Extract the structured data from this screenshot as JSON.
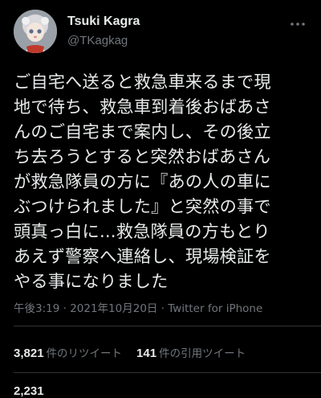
{
  "author": {
    "display_name": "Tsuki Kagra",
    "handle": "@TKagkag",
    "avatar_icon": "doll-avatar"
  },
  "more_icon": "more-dots-icon",
  "tweet": {
    "lines": [
      "ご自宅へ送ると救急車来るまで現",
      "地で待ち、救急車到着後おばあさ",
      "んのご自宅まで案内し、その後立",
      "ち去ろうとすると突然おばあさん",
      "が救急隊員の方に『あの人の車に",
      "ぶつけられました』と突然の事で",
      "頭真っ白に...救急隊員の方もとり",
      "あえず警察へ連絡し、現場検証を",
      "やる事になりました"
    ]
  },
  "meta": {
    "time": "午後3:19",
    "separator": " · ",
    "date": "2021年10月20日",
    "source": "Twitter for iPhone"
  },
  "stats": {
    "retweets_count": "3,821",
    "retweets_label": "件のリツイート",
    "quotes_count": "141",
    "quotes_label": "件の引用ツイート"
  },
  "partial_next_row": "2,231"
}
